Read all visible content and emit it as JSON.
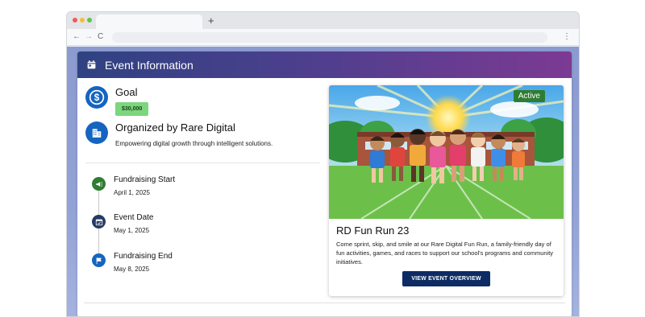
{
  "browser": {
    "new_tab_symbol": "+",
    "back_symbol": "←",
    "forward_symbol": "→",
    "reload_symbol": "C",
    "menu_symbol": "⋮"
  },
  "header": {
    "title": "Event Information",
    "icon": "calendar-icon"
  },
  "goal": {
    "label": "Goal",
    "amount": "$30,000",
    "icon": "dollar-icon"
  },
  "organizer": {
    "name": "Organized by Rare Digital",
    "description": "Empowering digital growth through intelligent solutions.",
    "icon": "building-icon"
  },
  "timeline": [
    {
      "title": "Fundraising Start",
      "date": "April 1, 2025",
      "icon": "megaphone-icon"
    },
    {
      "title": "Event Date",
      "date": "May 1, 2025",
      "icon": "calendar-check-icon"
    },
    {
      "title": "Fundraising End",
      "date": "May 8, 2025",
      "icon": "flag-icon"
    }
  ],
  "event": {
    "status": "Active",
    "title": "RD Fun Run 23",
    "description": "Come sprint, skip, and smile at our Rare Digital Fun Run, a family-friendly day of fun activities, games, and races to support our school's programs and community initiatives.",
    "button_label": "VIEW EVENT OVERVIEW"
  },
  "colors": {
    "header_gradient_start": "#2f4282",
    "header_gradient_end": "#7c3a93",
    "primary_blue": "#1565c0",
    "goal_badge": "#7bd67d",
    "status_green": "#2e7d32",
    "button_navy": "#0d2c64"
  }
}
